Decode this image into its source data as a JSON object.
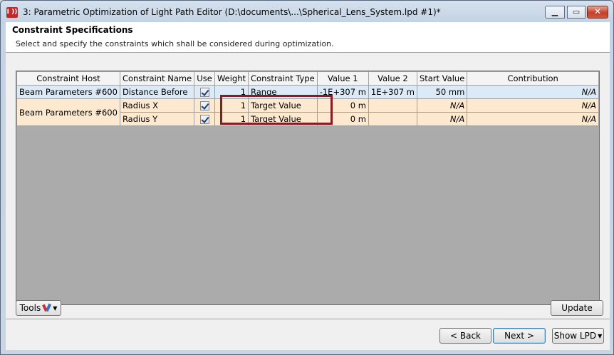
{
  "window": {
    "title": "3: Parametric Optimization of Light Path Editor (D:\\documents\\...\\Spherical_Lens_System.lpd #1)*",
    "app_icon_text": "I ))"
  },
  "header": {
    "title": "Constraint Specifications",
    "subtitle": "Select and specify the constraints which shall be considered during optimization."
  },
  "table": {
    "columns": [
      "Constraint Host",
      "Constraint Name",
      "Use",
      "Weight",
      "Constraint Type",
      "Value 1",
      "Value 2",
      "Start Value",
      "Contribution"
    ],
    "host_row1": "Beam Parameters #600",
    "host_group": "Beam Parameters #600",
    "rows": [
      {
        "name": "Distance Before",
        "use": true,
        "weight": "1",
        "type": "Range",
        "value1": "-1E+307 m",
        "value2": "1E+307 m",
        "start": "50 mm",
        "contribution": "N/A"
      },
      {
        "name": "Radius X",
        "use": true,
        "weight": "1",
        "type": "Target Value",
        "value1": "0 m",
        "value2": "",
        "start": "N/A",
        "contribution": "N/A"
      },
      {
        "name": "Radius Y",
        "use": true,
        "weight": "1",
        "type": "Target Value",
        "value1": "0 m",
        "value2": "",
        "start": "N/A",
        "contribution": "N/A"
      }
    ]
  },
  "buttons": {
    "tools": "Tools",
    "update": "Update",
    "back": "< Back",
    "next": "Next >",
    "show_lpd": "Show  LPD"
  },
  "colors": {
    "highlight": "#8b1a22",
    "row_selected": "#dce9f6",
    "row_group": "#fde9cf"
  }
}
